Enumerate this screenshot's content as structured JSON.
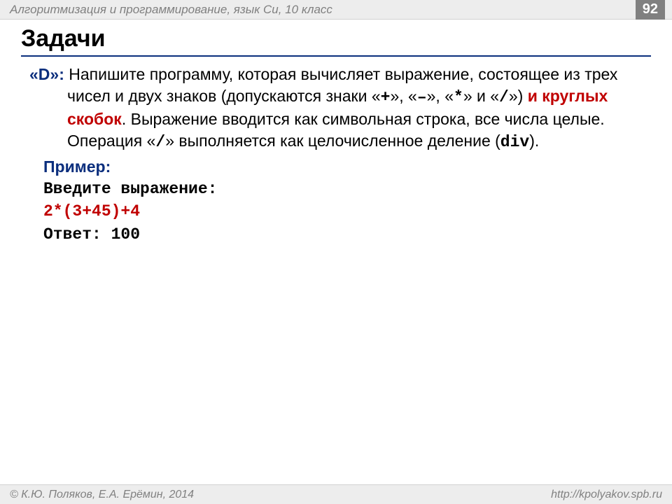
{
  "header": {
    "title": "Алгоритмизация и программирование, язык Си, 10 класс",
    "page": "92"
  },
  "title": "Задачи",
  "task": {
    "label": "«D»:",
    "line1_a": " Напишите программу, которая вычисляет выражение, состоящее из трех чисел и двух знаков (допускаются знаки «",
    "op_plus": "+",
    "mid1": "», «",
    "op_minus": "–",
    "mid2": "», «",
    "op_mul": "*",
    "mid3": "» и «",
    "op_div": "/",
    "line1_b": "») ",
    "red_phrase": "и круглых скобок",
    "line1_c": ". Выражение вводится как символьная строка, все числа целые. Операция «",
    "op_div2": "/",
    "line1_d": "» выполняется как целочисленное деление (",
    "div_kw": "div",
    "line1_e": ")."
  },
  "example": {
    "label": "Пример:",
    "prompt": "Введите выражение:",
    "input": "2*(3+45)+4",
    "answer_label": "Ответ: ",
    "answer_value": "100"
  },
  "footer": {
    "copyright": "© К.Ю. Поляков, Е.А. Ерёмин, 2014",
    "url": "http://kpolyakov.spb.ru"
  }
}
